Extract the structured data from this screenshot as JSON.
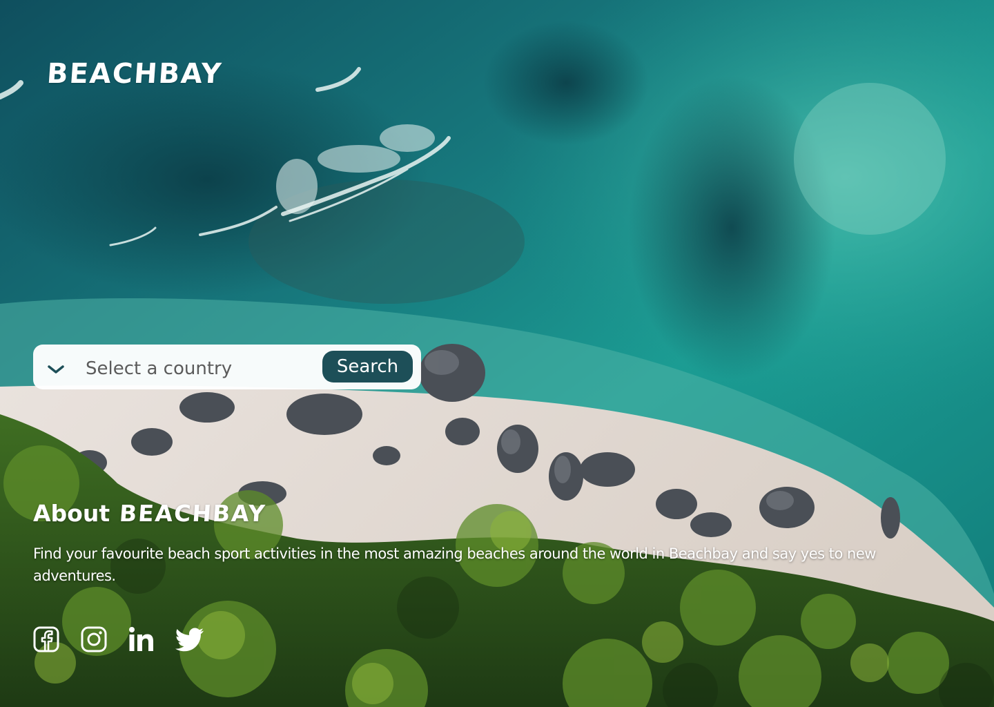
{
  "brand": {
    "logo_text": "BEACHBAY"
  },
  "search": {
    "select_placeholder": "Select a country",
    "button_label": "Search"
  },
  "about": {
    "title_prefix": "About",
    "title_brand": "BEACHBAY",
    "body": "Find your favourite beach sport activities in the most amazing beaches around the world in Beachbay and say yes to new adventures."
  },
  "social": {
    "icons": [
      "facebook-icon",
      "instagram-icon",
      "linkedin-icon",
      "twitter-icon"
    ]
  },
  "colors": {
    "button_bg": "#1d4f58",
    "text": "#ffffff",
    "search_bg": "#ffffff",
    "placeholder": "#5b5b5b"
  }
}
